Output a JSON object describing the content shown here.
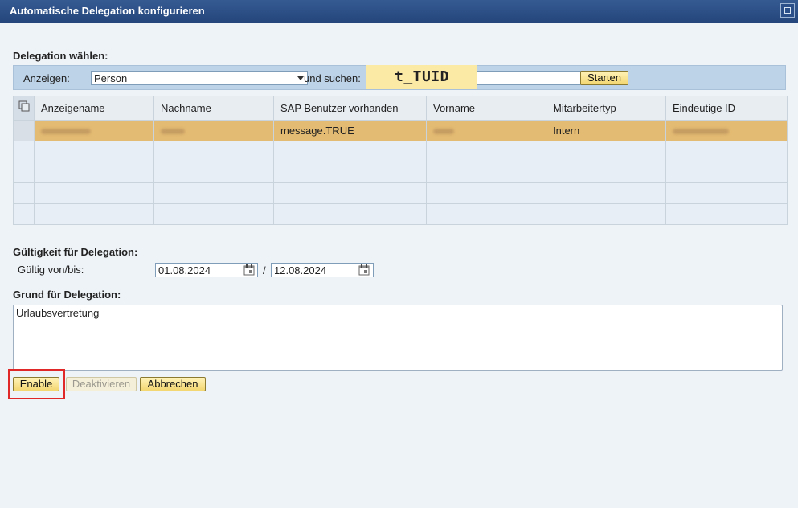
{
  "window": {
    "title": "Automatische Delegation konfigurieren"
  },
  "delegation": {
    "section_label": "Delegation wählen:",
    "show_label": "Anzeigen:",
    "show_value": "Person",
    "search_label": "und suchen:",
    "search_value": "",
    "start_button": "Starten",
    "overlay_label": "t_TUID"
  },
  "table": {
    "columns": [
      "Anzeigename",
      "Nachname",
      "SAP Benutzer vorhanden",
      "Vorname",
      "Mitarbeitertyp",
      "Eindeutige ID"
    ],
    "rows": [
      [
        "",
        "",
        "message.TRUE",
        "",
        "Intern",
        ""
      ]
    ]
  },
  "validity": {
    "section_label": "Gültigkeit für Delegation:",
    "range_label": "Gültig von/bis:",
    "from": "01.08.2024",
    "separator": "/",
    "to": "12.08.2024"
  },
  "reason": {
    "section_label": "Grund für Delegation:",
    "text": "Urlaubsvertretung"
  },
  "actions": {
    "enable": "Enable",
    "deactivate": "Deaktivieren",
    "cancel": "Abbrechen"
  },
  "colors": {
    "titlebar": "#24467c",
    "selected_row": "#e4bb72",
    "button": "#f3d670",
    "highlight": "#e12828"
  }
}
